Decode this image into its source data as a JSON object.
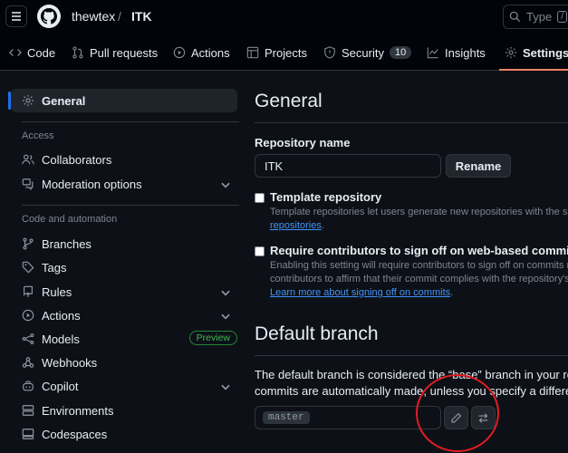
{
  "header": {
    "owner": "thewtex",
    "separator": "/",
    "repo": "ITK",
    "search_text": "Type",
    "search_key": "/"
  },
  "repo_tabs": [
    {
      "label": "Code",
      "icon": "code-icon"
    },
    {
      "label": "Pull requests",
      "icon": "git-pull-request-icon"
    },
    {
      "label": "Actions",
      "icon": "play-icon"
    },
    {
      "label": "Projects",
      "icon": "table-icon"
    },
    {
      "label": "Security",
      "icon": "shield-icon",
      "count": "10"
    },
    {
      "label": "Insights",
      "icon": "graph-icon"
    },
    {
      "label": "Settings",
      "icon": "gear-icon",
      "active": true
    }
  ],
  "sidebar": {
    "general": "General",
    "access_heading": "Access",
    "collaborators": "Collaborators",
    "moderation": "Moderation options",
    "code_heading": "Code and automation",
    "branches": "Branches",
    "tags": "Tags",
    "rules": "Rules",
    "actions": "Actions",
    "models": "Models",
    "models_badge": "Preview",
    "webhooks": "Webhooks",
    "copilot": "Copilot",
    "environments": "Environments",
    "codespaces": "Codespaces"
  },
  "main": {
    "title": "General",
    "repo_name_label": "Repository name",
    "repo_name_value": "ITK",
    "rename_button": "Rename",
    "template_title": "Template repository",
    "template_desc_1": "Template repositories let users generate new repositories with the sam",
    "template_desc_link": "repositories",
    "template_desc_end": ".",
    "signoff_title": "Require contributors to sign off on web-based commits",
    "signoff_desc_1": "Enabling this setting will require contributors to sign off on commits m",
    "signoff_desc_2": "contributors to affirm that their commit complies with the repository's",
    "signoff_link": "Learn more about signing off on commits",
    "signoff_link_end": ".",
    "default_branch_title": "Default branch",
    "default_branch_desc_1": "The default branch is considered the “base” branch in your repos",
    "default_branch_desc_2": "commits are automatically made, unless you specify a different b",
    "branch_name": "master"
  },
  "colors": {
    "accent_tab": "#f78166",
    "active_bar": "#1f6feb",
    "link": "#4493f8",
    "annotation": "#e11d22"
  }
}
